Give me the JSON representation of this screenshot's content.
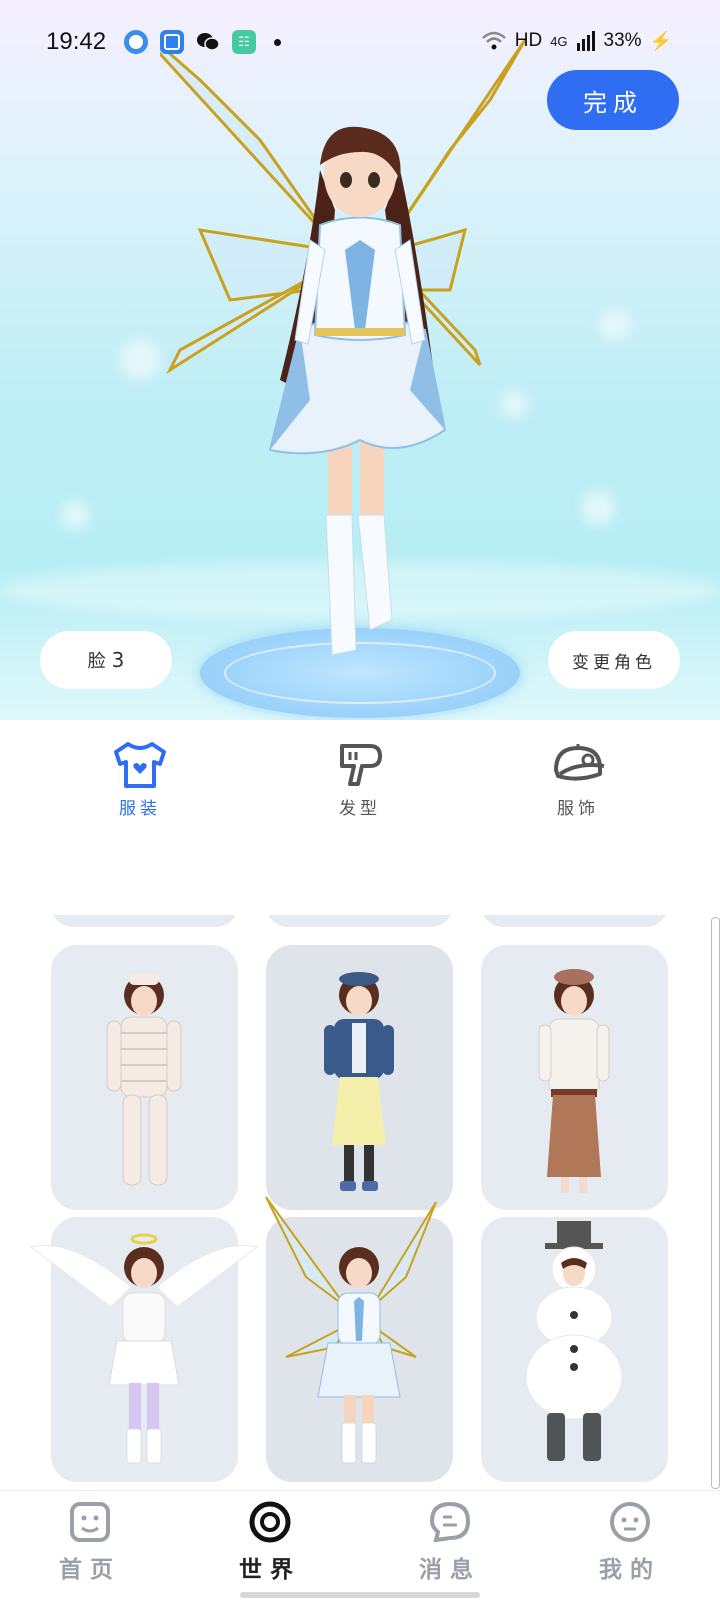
{
  "status_bar": {
    "time": "19:42",
    "network": "HD",
    "signal": "4G",
    "battery": "33%",
    "icons": [
      "app-icon-blue-ring",
      "app-icon-blue-square",
      "wechat-icon",
      "app-icon-green",
      "notification-dot"
    ]
  },
  "preview": {
    "done_label": "完成",
    "face_label": "脸",
    "face_value": "3",
    "change_character_label": "变更角色"
  },
  "tabs": [
    {
      "label": "服装",
      "icon": "shirt-icon",
      "active": true
    },
    {
      "label": "发型",
      "icon": "hair-dryer-icon",
      "active": false
    },
    {
      "label": "服饰",
      "icon": "cap-icon",
      "active": false
    }
  ],
  "outfits": [
    {
      "name": "mummy-costume"
    },
    {
      "name": "denim-jacket-yellow-skirt"
    },
    {
      "name": "beret-coat-brown-skirt"
    },
    {
      "name": "angel-wings-outfit"
    },
    {
      "name": "fairy-wings-outfit",
      "selected": true
    },
    {
      "name": "snowman-costume"
    }
  ],
  "bottom_nav": [
    {
      "label": "首页",
      "icon": "smile-square-icon",
      "active": false
    },
    {
      "label": "世界",
      "icon": "target-ring-icon",
      "active": true
    },
    {
      "label": "消息",
      "icon": "chat-bubble-icon",
      "active": false
    },
    {
      "label": "我的",
      "icon": "face-circle-icon",
      "active": false
    }
  ],
  "colors": {
    "accent": "#2f6ef3",
    "card_bg": "#e6ebf1",
    "inactive_text": "#9aa0a8"
  }
}
